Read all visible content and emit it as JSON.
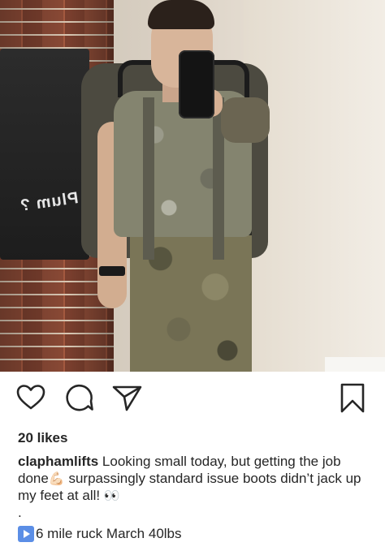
{
  "post": {
    "photo": {
      "towel_text": "Plum ?",
      "description_icon": "mirror-selfie-photo"
    },
    "actions": {
      "like_icon": "heart-outline-icon",
      "comment_icon": "speech-bubble-icon",
      "share_icon": "paper-plane-icon",
      "save_icon": "bookmark-icon"
    },
    "likes": "20 likes",
    "caption": {
      "username": "claphamlifts",
      "text_part1": " Looking small today, but getting the job done",
      "emoji_flex": "💪🏻",
      "text_part2": " surpassingly standard issue boots didn’t jack up my feet at all! ",
      "emoji_eyes": "👀",
      "dot": ".",
      "play_icon": "play-button-icon",
      "second_line": "6 mile ruck March 40lbs"
    }
  },
  "colors": {
    "text": "#262626",
    "play_box": "#5b8ee6",
    "background": "#ffffff"
  }
}
